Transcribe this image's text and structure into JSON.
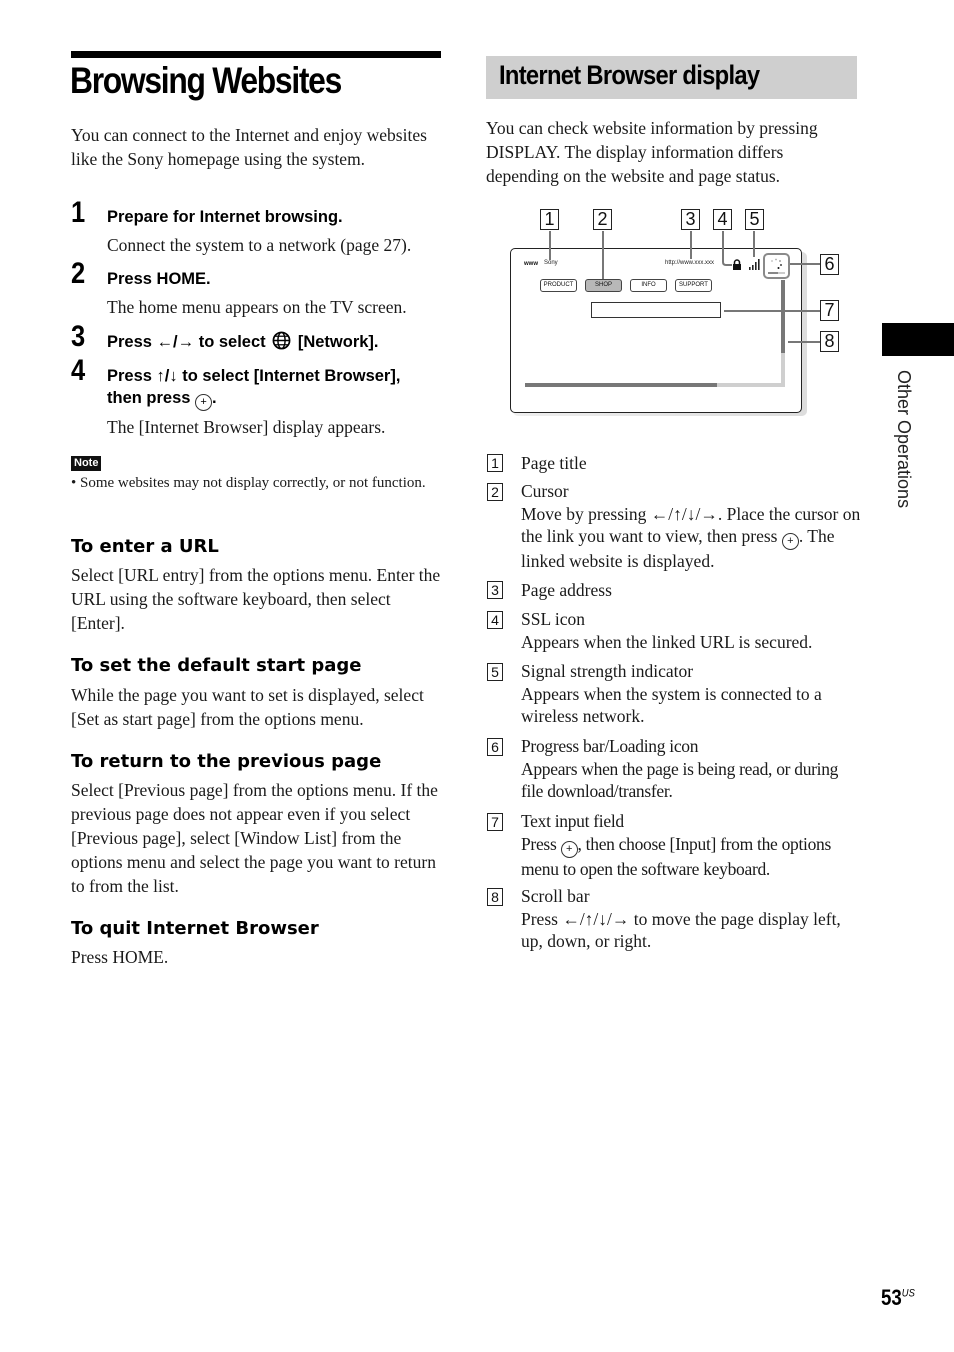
{
  "page": {
    "title": "Browsing Websites",
    "intro": "You can connect to the Internet and enjoy websites like the Sony homepage using the system.",
    "steps": [
      {
        "num": "1",
        "head": "Prepare for Internet browsing.",
        "body": "Connect the system to a network (page 27)."
      },
      {
        "num": "2",
        "head": "Press HOME.",
        "body": "The home menu appears on the TV screen."
      },
      {
        "num": "3",
        "head_pre": "Press ←/→ to select",
        "head_post": "[Network].",
        "icon": "globe-network-icon"
      },
      {
        "num": "4",
        "head_line1": "Press ↑/↓ to select [Internet Browser],",
        "head_line2_pre": "then press",
        "head_line2_post": ".",
        "body": "The [Internet Browser] display appears."
      }
    ],
    "note": {
      "badge": "Note",
      "text": "• Some websites may not display correctly, or not function."
    },
    "subsections": [
      {
        "head": "To enter a URL",
        "body": "Select [URL entry] from the options menu. Enter the URL using the software keyboard, then select [Enter]."
      },
      {
        "head": "To set the default start page",
        "body": "While the page you want to set is displayed, select [Set as start page] from the options menu."
      },
      {
        "head": "To return to the previous page",
        "body": "Select [Previous page] from the options menu. If the previous page does not appear even if you select [Previous page], select [Window List] from the options menu and select the page you want to return to from the list."
      },
      {
        "head": "To quit Internet Browser",
        "body": "Press HOME."
      }
    ]
  },
  "browser_section": {
    "title": "Internet Browser display",
    "intro": "You can check website information by pressing DISPLAY. The display information differs depending on the website and page status.",
    "diagram": {
      "callouts": [
        "1",
        "2",
        "3",
        "4",
        "5",
        "6",
        "7",
        "8"
      ],
      "page_title_text": "Sony",
      "www_label": "www",
      "url_text": "http://www.xxx.xxx",
      "nav_buttons": [
        "PRODUCT",
        "SHOP",
        "INFO",
        "SUPPORT"
      ],
      "selected_button": "SHOP",
      "horizontal_scroll_fraction": 0.74,
      "vertical_scroll_fraction": 0.7
    },
    "legend": [
      {
        "num": "1",
        "title": "Page title"
      },
      {
        "num": "2",
        "title": "Cursor",
        "desc_pre": "Move by pressing ←/↑/↓/→. Place the cursor on the link you want to view, then press",
        "desc_post": ". The linked website is displayed."
      },
      {
        "num": "3",
        "title": "Page address"
      },
      {
        "num": "4",
        "title": "SSL icon",
        "desc": "Appears when the linked URL is secured."
      },
      {
        "num": "5",
        "title": "Signal strength indicator",
        "desc": "Appears when the system is connected to a wireless network."
      },
      {
        "num": "6",
        "title": "Progress bar/Loading icon",
        "desc": "Appears when the page is being read, or during file download/transfer."
      },
      {
        "num": "7",
        "title": "Text input field",
        "desc_pre": "Press",
        "desc_post": ", then choose [Input] from the options menu to open the software keyboard."
      },
      {
        "num": "8",
        "title": "Scroll bar",
        "desc": "Press ←/↑/↓/→ to move the page display left, up, down, or right."
      }
    ]
  },
  "side_tab": {
    "label": "Other Operations"
  },
  "footer": {
    "page_number": "53",
    "region": "US"
  },
  "icons": {
    "enter_button": "+"
  }
}
